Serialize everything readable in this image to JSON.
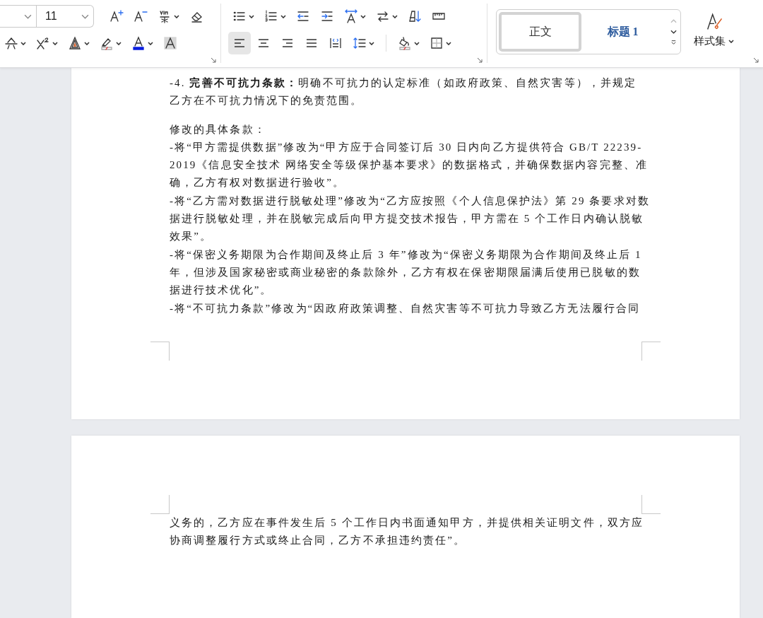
{
  "toolbar": {
    "font_size": "11",
    "align_buttons": [
      {
        "selected": true
      },
      {
        "selected": false
      },
      {
        "selected": false
      },
      {
        "selected": false
      },
      {
        "selected": false
      }
    ],
    "styles": [
      {
        "label": "正文",
        "kind": "body",
        "selected": true
      },
      {
        "label": "标题 1",
        "kind": "heading",
        "selected": false
      }
    ],
    "style_set_label": "样式集"
  },
  "pages": [
    {
      "paragraphs": [
        {
          "space_before": false,
          "lines": [
            "-4. **完善不可抗力条款：**明确不可抗力的认定标准（如政府政策、自然灾害等），并规定",
            "乙方在不可抗力情况下的免责范围。"
          ]
        },
        {
          "space_before": true,
          "lines": [
            "修改的具体条款："
          ]
        },
        {
          "space_before": false,
          "lines": [
            "-将“甲方需提供数据”修改为“甲方应于合同签订后 30 日内向乙方提供符合 GB/T 22239-",
            "2019《信息安全技术 网络安全等级保护基本要求》的数据格式，并确保数据内容完整、准",
            "确，乙方有权对数据进行验收”。"
          ]
        },
        {
          "space_before": false,
          "lines": [
            "-将“乙方需对数据进行脱敏处理”修改为“乙方应按照《个人信息保护法》第 29 条要求对数",
            "据进行脱敏处理，并在脱敏完成后向甲方提交技术报告，甲方需在 5 个工作日内确认脱敏",
            "效果”。"
          ]
        },
        {
          "space_before": false,
          "lines": [
            "-将“保密义务期限为合作期间及终止后 3 年”修改为“保密义务期限为合作期间及终止后 1",
            "年，但涉及国家秘密或商业秘密的条款除外，乙方有权在保密期限届满后使用已脱敏的数",
            "据进行技术优化”。"
          ]
        },
        {
          "space_before": false,
          "lines": [
            "-将“不可抗力条款”修改为“因政府政策调整、自然灾害等不可抗力导致乙方无法履行合同"
          ]
        }
      ]
    },
    {
      "paragraphs": [
        {
          "space_before": false,
          "lines": [
            "义务的，乙方应在事件发生后 5 个工作日内书面通知甲方，并提供相关证明文件，双方应",
            "协商调整履行方式或终止合同，乙方不承担违约责任”。"
          ]
        }
      ]
    }
  ]
}
